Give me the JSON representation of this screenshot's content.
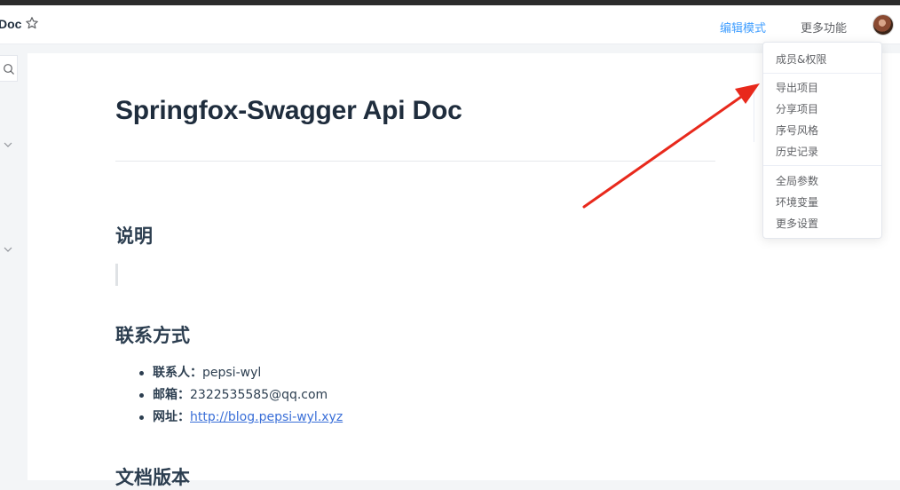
{
  "header": {
    "doc_title": "Doc",
    "edit_mode": "编辑模式",
    "more_functions": "更多功能"
  },
  "page": {
    "title": "Springfox-Swagger Api Doc",
    "section_description": "说明",
    "section_contact": "联系方式",
    "section_version": "文档版本",
    "contact": {
      "person_label": "联系人：",
      "person_value": "pepsi-wyl",
      "email_label": "邮箱：",
      "email_value": "2322535585@qq.com",
      "url_label": "网址：",
      "url_value": "http://blog.pepsi-wyl.xyz"
    }
  },
  "dropdown": {
    "members": "成员&权限",
    "export": "导出项目",
    "share": "分享项目",
    "numbering": "序号风格",
    "history": "历史记录",
    "global_params": "全局参数",
    "env_vars": "环境变量",
    "more_settings": "更多设置"
  },
  "colors": {
    "accent": "#409eff",
    "annotation_arrow": "#e8291c"
  },
  "icons": {
    "star": "star-outline-icon",
    "search": "search-icon",
    "chevron": "chevron-down-icon"
  }
}
